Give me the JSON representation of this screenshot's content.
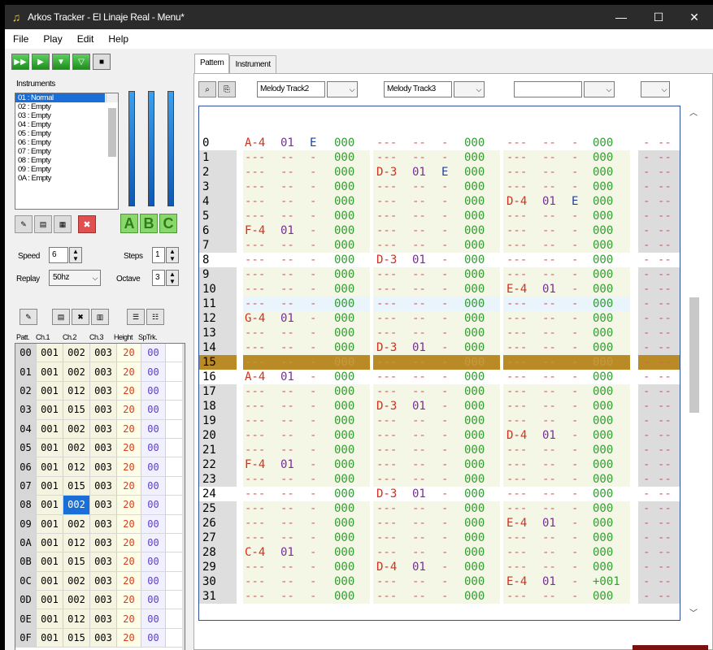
{
  "window": {
    "title": "Arkos Tracker - El Linaje Real - Menu*",
    "controls": {
      "minimize": "—",
      "maximize": "☐",
      "close": "✕"
    }
  },
  "menu": [
    "File",
    "Play",
    "Edit",
    "Help"
  ],
  "labels": {
    "instruments": "Instruments",
    "speed": "Speed",
    "steps": "Steps",
    "replay": "Replay",
    "octave": "Octave"
  },
  "instruments": [
    "01 : Normal",
    "02 : Empty",
    "03 : Empty",
    "04 : Empty",
    "05 : Empty",
    "06 : Empty",
    "07 : Empty",
    "08 : Empty",
    "09 : Empty",
    "0A : Empty"
  ],
  "settings": {
    "speed": "6",
    "steps": "1",
    "replay": "50hz",
    "octave": "3"
  },
  "abc_letters": [
    "A",
    "B",
    "C"
  ],
  "pattern_headers": [
    "Patt.",
    "Ch.1",
    "Ch.2",
    "Ch.3",
    "Height",
    "SpTrk."
  ],
  "patterns": [
    [
      "00",
      "001",
      "002",
      "003",
      "20",
      "00"
    ],
    [
      "01",
      "001",
      "002",
      "003",
      "20",
      "00"
    ],
    [
      "02",
      "001",
      "012",
      "003",
      "20",
      "00"
    ],
    [
      "03",
      "001",
      "015",
      "003",
      "20",
      "00"
    ],
    [
      "04",
      "001",
      "002",
      "003",
      "20",
      "00"
    ],
    [
      "05",
      "001",
      "002",
      "003",
      "20",
      "00"
    ],
    [
      "06",
      "001",
      "012",
      "003",
      "20",
      "00"
    ],
    [
      "07",
      "001",
      "015",
      "003",
      "20",
      "00"
    ],
    [
      "08",
      "001",
      "002",
      "003",
      "20",
      "00"
    ],
    [
      "09",
      "001",
      "002",
      "003",
      "20",
      "00"
    ],
    [
      "0A",
      "001",
      "012",
      "003",
      "20",
      "00"
    ],
    [
      "0B",
      "001",
      "015",
      "003",
      "20",
      "00"
    ],
    [
      "0C",
      "001",
      "002",
      "003",
      "20",
      "00"
    ],
    [
      "0D",
      "001",
      "002",
      "003",
      "20",
      "00"
    ],
    [
      "0E",
      "001",
      "012",
      "003",
      "20",
      "00"
    ],
    [
      "0F",
      "001",
      "015",
      "003",
      "20",
      "00"
    ]
  ],
  "tabs": [
    "Pattern",
    "Instrument"
  ],
  "track_names": [
    "Melody Track2",
    "Melody Track3",
    ""
  ],
  "rows": [
    {
      "n": "0",
      "c1": [
        "A-4",
        "01",
        "E",
        "000"
      ],
      "c2": [
        "---",
        "--",
        "-",
        "000"
      ],
      "c3": [
        "---",
        "--",
        "-",
        "000"
      ]
    },
    {
      "n": "1",
      "c1": [
        "---",
        "--",
        "-",
        "000"
      ],
      "c2": [
        "---",
        "--",
        "-",
        "000"
      ],
      "c3": [
        "---",
        "--",
        "-",
        "000"
      ]
    },
    {
      "n": "2",
      "c1": [
        "---",
        "--",
        "-",
        "000"
      ],
      "c2": [
        "D-3",
        "01",
        "E",
        "000"
      ],
      "c3": [
        "---",
        "--",
        "-",
        "000"
      ]
    },
    {
      "n": "3",
      "c1": [
        "---",
        "--",
        "-",
        "000"
      ],
      "c2": [
        "---",
        "--",
        "-",
        "000"
      ],
      "c3": [
        "---",
        "--",
        "-",
        "000"
      ]
    },
    {
      "n": "4",
      "c1": [
        "---",
        "--",
        "-",
        "000"
      ],
      "c2": [
        "---",
        "--",
        "-",
        "000"
      ],
      "c3": [
        "D-4",
        "01",
        "E",
        "000"
      ]
    },
    {
      "n": "5",
      "c1": [
        "---",
        "--",
        "-",
        "000"
      ],
      "c2": [
        "---",
        "--",
        "-",
        "000"
      ],
      "c3": [
        "---",
        "--",
        "-",
        "000"
      ]
    },
    {
      "n": "6",
      "c1": [
        "F-4",
        "01",
        "-",
        "000"
      ],
      "c2": [
        "---",
        "--",
        "-",
        "000"
      ],
      "c3": [
        "---",
        "--",
        "-",
        "000"
      ]
    },
    {
      "n": "7",
      "c1": [
        "---",
        "--",
        "-",
        "000"
      ],
      "c2": [
        "---",
        "--",
        "-",
        "000"
      ],
      "c3": [
        "---",
        "--",
        "-",
        "000"
      ]
    },
    {
      "n": "8",
      "c1": [
        "---",
        "--",
        "-",
        "000"
      ],
      "c2": [
        "D-3",
        "01",
        "-",
        "000"
      ],
      "c3": [
        "---",
        "--",
        "-",
        "000"
      ]
    },
    {
      "n": "9",
      "c1": [
        "---",
        "--",
        "-",
        "000"
      ],
      "c2": [
        "---",
        "--",
        "-",
        "000"
      ],
      "c3": [
        "---",
        "--",
        "-",
        "000"
      ]
    },
    {
      "n": "10",
      "c1": [
        "---",
        "--",
        "-",
        "000"
      ],
      "c2": [
        "---",
        "--",
        "-",
        "000"
      ],
      "c3": [
        "E-4",
        "01",
        "-",
        "000"
      ]
    },
    {
      "n": "11",
      "c1": [
        "---",
        "--",
        "-",
        "000"
      ],
      "c2": [
        "---",
        "--",
        "-",
        "000"
      ],
      "c3": [
        "---",
        "--",
        "-",
        "000"
      ]
    },
    {
      "n": "12",
      "c1": [
        "G-4",
        "01",
        "-",
        "000"
      ],
      "c2": [
        "---",
        "--",
        "-",
        "000"
      ],
      "c3": [
        "---",
        "--",
        "-",
        "000"
      ]
    },
    {
      "n": "13",
      "c1": [
        "---",
        "--",
        "-",
        "000"
      ],
      "c2": [
        "---",
        "--",
        "-",
        "000"
      ],
      "c3": [
        "---",
        "--",
        "-",
        "000"
      ]
    },
    {
      "n": "14",
      "c1": [
        "---",
        "--",
        "-",
        "000"
      ],
      "c2": [
        "D-3",
        "01",
        "-",
        "000"
      ],
      "c3": [
        "---",
        "--",
        "-",
        "000"
      ]
    },
    {
      "n": "15",
      "c1": [
        "---",
        "--",
        "-",
        "000"
      ],
      "c2": [
        "---",
        "--",
        "-",
        "000"
      ],
      "c3": [
        "---",
        "--",
        "-",
        "000"
      ]
    },
    {
      "n": "16",
      "c1": [
        "A-4",
        "01",
        "-",
        "000"
      ],
      "c2": [
        "---",
        "--",
        "-",
        "000"
      ],
      "c3": [
        "---",
        "--",
        "-",
        "000"
      ]
    },
    {
      "n": "17",
      "c1": [
        "---",
        "--",
        "-",
        "000"
      ],
      "c2": [
        "---",
        "--",
        "-",
        "000"
      ],
      "c3": [
        "---",
        "--",
        "-",
        "000"
      ]
    },
    {
      "n": "18",
      "c1": [
        "---",
        "--",
        "-",
        "000"
      ],
      "c2": [
        "D-3",
        "01",
        "-",
        "000"
      ],
      "c3": [
        "---",
        "--",
        "-",
        "000"
      ]
    },
    {
      "n": "19",
      "c1": [
        "---",
        "--",
        "-",
        "000"
      ],
      "c2": [
        "---",
        "--",
        "-",
        "000"
      ],
      "c3": [
        "---",
        "--",
        "-",
        "000"
      ]
    },
    {
      "n": "20",
      "c1": [
        "---",
        "--",
        "-",
        "000"
      ],
      "c2": [
        "---",
        "--",
        "-",
        "000"
      ],
      "c3": [
        "D-4",
        "01",
        "-",
        "000"
      ]
    },
    {
      "n": "21",
      "c1": [
        "---",
        "--",
        "-",
        "000"
      ],
      "c2": [
        "---",
        "--",
        "-",
        "000"
      ],
      "c3": [
        "---",
        "--",
        "-",
        "000"
      ]
    },
    {
      "n": "22",
      "c1": [
        "F-4",
        "01",
        "-",
        "000"
      ],
      "c2": [
        "---",
        "--",
        "-",
        "000"
      ],
      "c3": [
        "---",
        "--",
        "-",
        "000"
      ]
    },
    {
      "n": "23",
      "c1": [
        "---",
        "--",
        "-",
        "000"
      ],
      "c2": [
        "---",
        "--",
        "-",
        "000"
      ],
      "c3": [
        "---",
        "--",
        "-",
        "000"
      ]
    },
    {
      "n": "24",
      "c1": [
        "---",
        "--",
        "-",
        "000"
      ],
      "c2": [
        "D-3",
        "01",
        "-",
        "000"
      ],
      "c3": [
        "---",
        "--",
        "-",
        "000"
      ]
    },
    {
      "n": "25",
      "c1": [
        "---",
        "--",
        "-",
        "000"
      ],
      "c2": [
        "---",
        "--",
        "-",
        "000"
      ],
      "c3": [
        "---",
        "--",
        "-",
        "000"
      ]
    },
    {
      "n": "26",
      "c1": [
        "---",
        "--",
        "-",
        "000"
      ],
      "c2": [
        "---",
        "--",
        "-",
        "000"
      ],
      "c3": [
        "E-4",
        "01",
        "-",
        "000"
      ]
    },
    {
      "n": "27",
      "c1": [
        "---",
        "--",
        "-",
        "000"
      ],
      "c2": [
        "---",
        "--",
        "-",
        "000"
      ],
      "c3": [
        "---",
        "--",
        "-",
        "000"
      ]
    },
    {
      "n": "28",
      "c1": [
        "C-4",
        "01",
        "-",
        "000"
      ],
      "c2": [
        "---",
        "--",
        "-",
        "000"
      ],
      "c3": [
        "---",
        "--",
        "-",
        "000"
      ]
    },
    {
      "n": "29",
      "c1": [
        "---",
        "--",
        "-",
        "000"
      ],
      "c2": [
        "D-4",
        "01",
        "-",
        "000"
      ],
      "c3": [
        "---",
        "--",
        "-",
        "000"
      ]
    },
    {
      "n": "30",
      "c1": [
        "---",
        "--",
        "-",
        "000"
      ],
      "c2": [
        "---",
        "--",
        "-",
        "000"
      ],
      "c3": [
        "E-4",
        "01",
        "-",
        "+001"
      ]
    },
    {
      "n": "31",
      "c1": [
        "---",
        "--",
        "-",
        "000"
      ],
      "c2": [
        "---",
        "--",
        "-",
        "000"
      ],
      "c3": [
        "---",
        "--",
        "-",
        "000"
      ]
    }
  ],
  "extra_col": [
    "-",
    "--"
  ],
  "highlight_rows": [
    0,
    8,
    16,
    24
  ],
  "cursor_row": 15,
  "light_rows": [
    11
  ],
  "colors": {
    "cursor": "#b98a25",
    "accent": "#1a6ed8",
    "note": "#d03020",
    "instrument": "#7a2e9a",
    "volume": "#30a030"
  }
}
